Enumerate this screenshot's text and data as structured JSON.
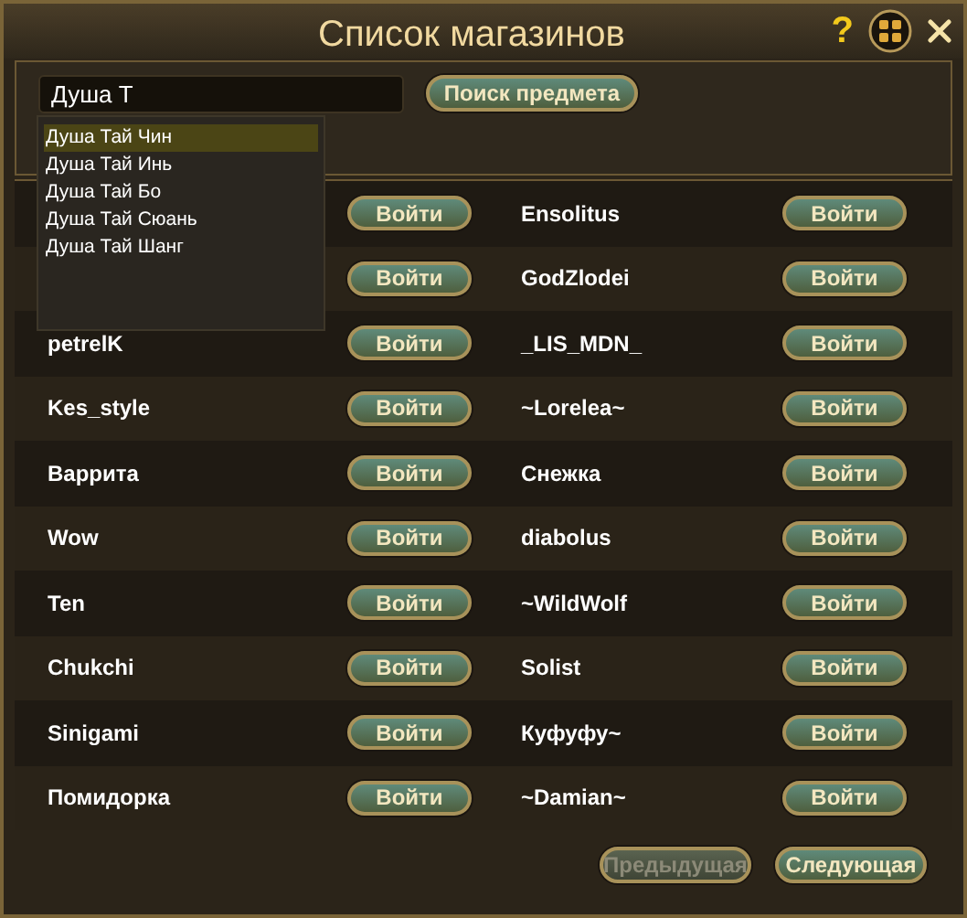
{
  "window": {
    "title": "Список магазинов",
    "help": "?"
  },
  "search": {
    "value": "Душа Т",
    "button": "Поиск предмета"
  },
  "suggestions": [
    {
      "label": "Душа Тай Чин",
      "selected": true
    },
    {
      "label": "Душа Тай Инь",
      "selected": false
    },
    {
      "label": "Душа Тай Бо",
      "selected": false
    },
    {
      "label": "Душа Тай Сюань",
      "selected": false
    },
    {
      "label": "Душа Тай Шанг",
      "selected": false
    }
  ],
  "rows": [
    [
      {
        "button": "Войти"
      },
      {
        "name": "Ensolitus",
        "button": "Войти"
      }
    ],
    [
      {
        "button": "Войти"
      },
      {
        "name": "GodZlodei",
        "button": "Войти"
      }
    ],
    [
      {
        "name": "petrelK",
        "button": "Войти"
      },
      {
        "name": "_LIS_MDN_",
        "button": "Войти"
      }
    ],
    [
      {
        "name": "Kes_style",
        "button": "Войти"
      },
      {
        "name": "~Lorelea~",
        "button": "Войти"
      }
    ],
    [
      {
        "name": "Варрита",
        "button": "Войти"
      },
      {
        "name": "Снежка",
        "button": "Войти"
      }
    ],
    [
      {
        "name": "Wow",
        "button": "Войти"
      },
      {
        "name": "diabolus",
        "button": "Войти"
      }
    ],
    [
      {
        "name": "Ten",
        "button": "Войти"
      },
      {
        "name": "~WildWolf",
        "button": "Войти"
      }
    ],
    [
      {
        "name": "Chukchi",
        "button": "Войти"
      },
      {
        "name": "Solist",
        "button": "Войти"
      }
    ],
    [
      {
        "name": "Sinigami",
        "button": "Войти"
      },
      {
        "name": "Куфуфу~",
        "button": "Войти"
      }
    ],
    [
      {
        "name": "Помидорка",
        "button": "Войти"
      },
      {
        "name": "~Damian~",
        "button": "Войти"
      }
    ]
  ],
  "pager": [
    {
      "label": "Предыдущая",
      "disabled": true
    },
    {
      "label": "Следующая",
      "disabled": false
    }
  ]
}
